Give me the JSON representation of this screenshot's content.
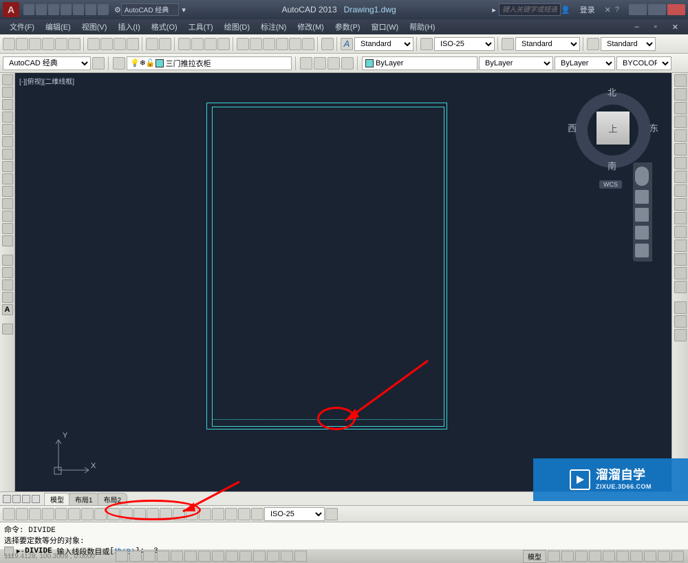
{
  "title": {
    "app": "AutoCAD 2013",
    "doc": "Drawing1.dwg",
    "search_placeholder": "键入关键字或短语",
    "login": "登录",
    "workspace": "AutoCAD 经典"
  },
  "menus": [
    "文件(F)",
    "编辑(E)",
    "视图(V)",
    "插入(I)",
    "格式(O)",
    "工具(T)",
    "绘图(D)",
    "标注(N)",
    "修改(M)",
    "参数(P)",
    "窗口(W)",
    "帮助(H)"
  ],
  "styles": {
    "text": "Standard",
    "dim": "ISO-25",
    "table": "Standard",
    "ml": "Standard"
  },
  "layer": {
    "ws_label": "AutoCAD 经典",
    "current": "三门推拉衣柜",
    "bylayer1": "ByLayer",
    "bylayer2": "ByLayer",
    "bylayer3": "ByLayer",
    "bycolor": "BYCOLOR"
  },
  "viewcube": {
    "top": "上",
    "n": "北",
    "s": "南",
    "e": "东",
    "w": "西",
    "wcs": "WCS"
  },
  "viewport_label": "[-][俯视][二维线框]",
  "ucs": {
    "x": "X",
    "y": "Y"
  },
  "tabs": [
    "模型",
    "布局1",
    "布局2"
  ],
  "dim_select": "ISO-25",
  "command": {
    "line1": "命令:  DIVIDE",
    "line2": "选择要定数等分的对象:",
    "prompt_cmd": "DIVIDE",
    "prompt_text": "输入线段数目或",
    "prompt_opt1": "[",
    "prompt_opt2": "块(B)",
    "prompt_opt3": "]:",
    "prompt_val": "3"
  },
  "status": {
    "coords": "1119.4128, 100.3009 , 0.0000",
    "model": "模型"
  },
  "watermark": {
    "brand": "溜溜自学",
    "sub": "ZIXUE.3D66.COM"
  },
  "colors": {
    "accent": "#3dd6d6",
    "anno": "#ff0000"
  }
}
